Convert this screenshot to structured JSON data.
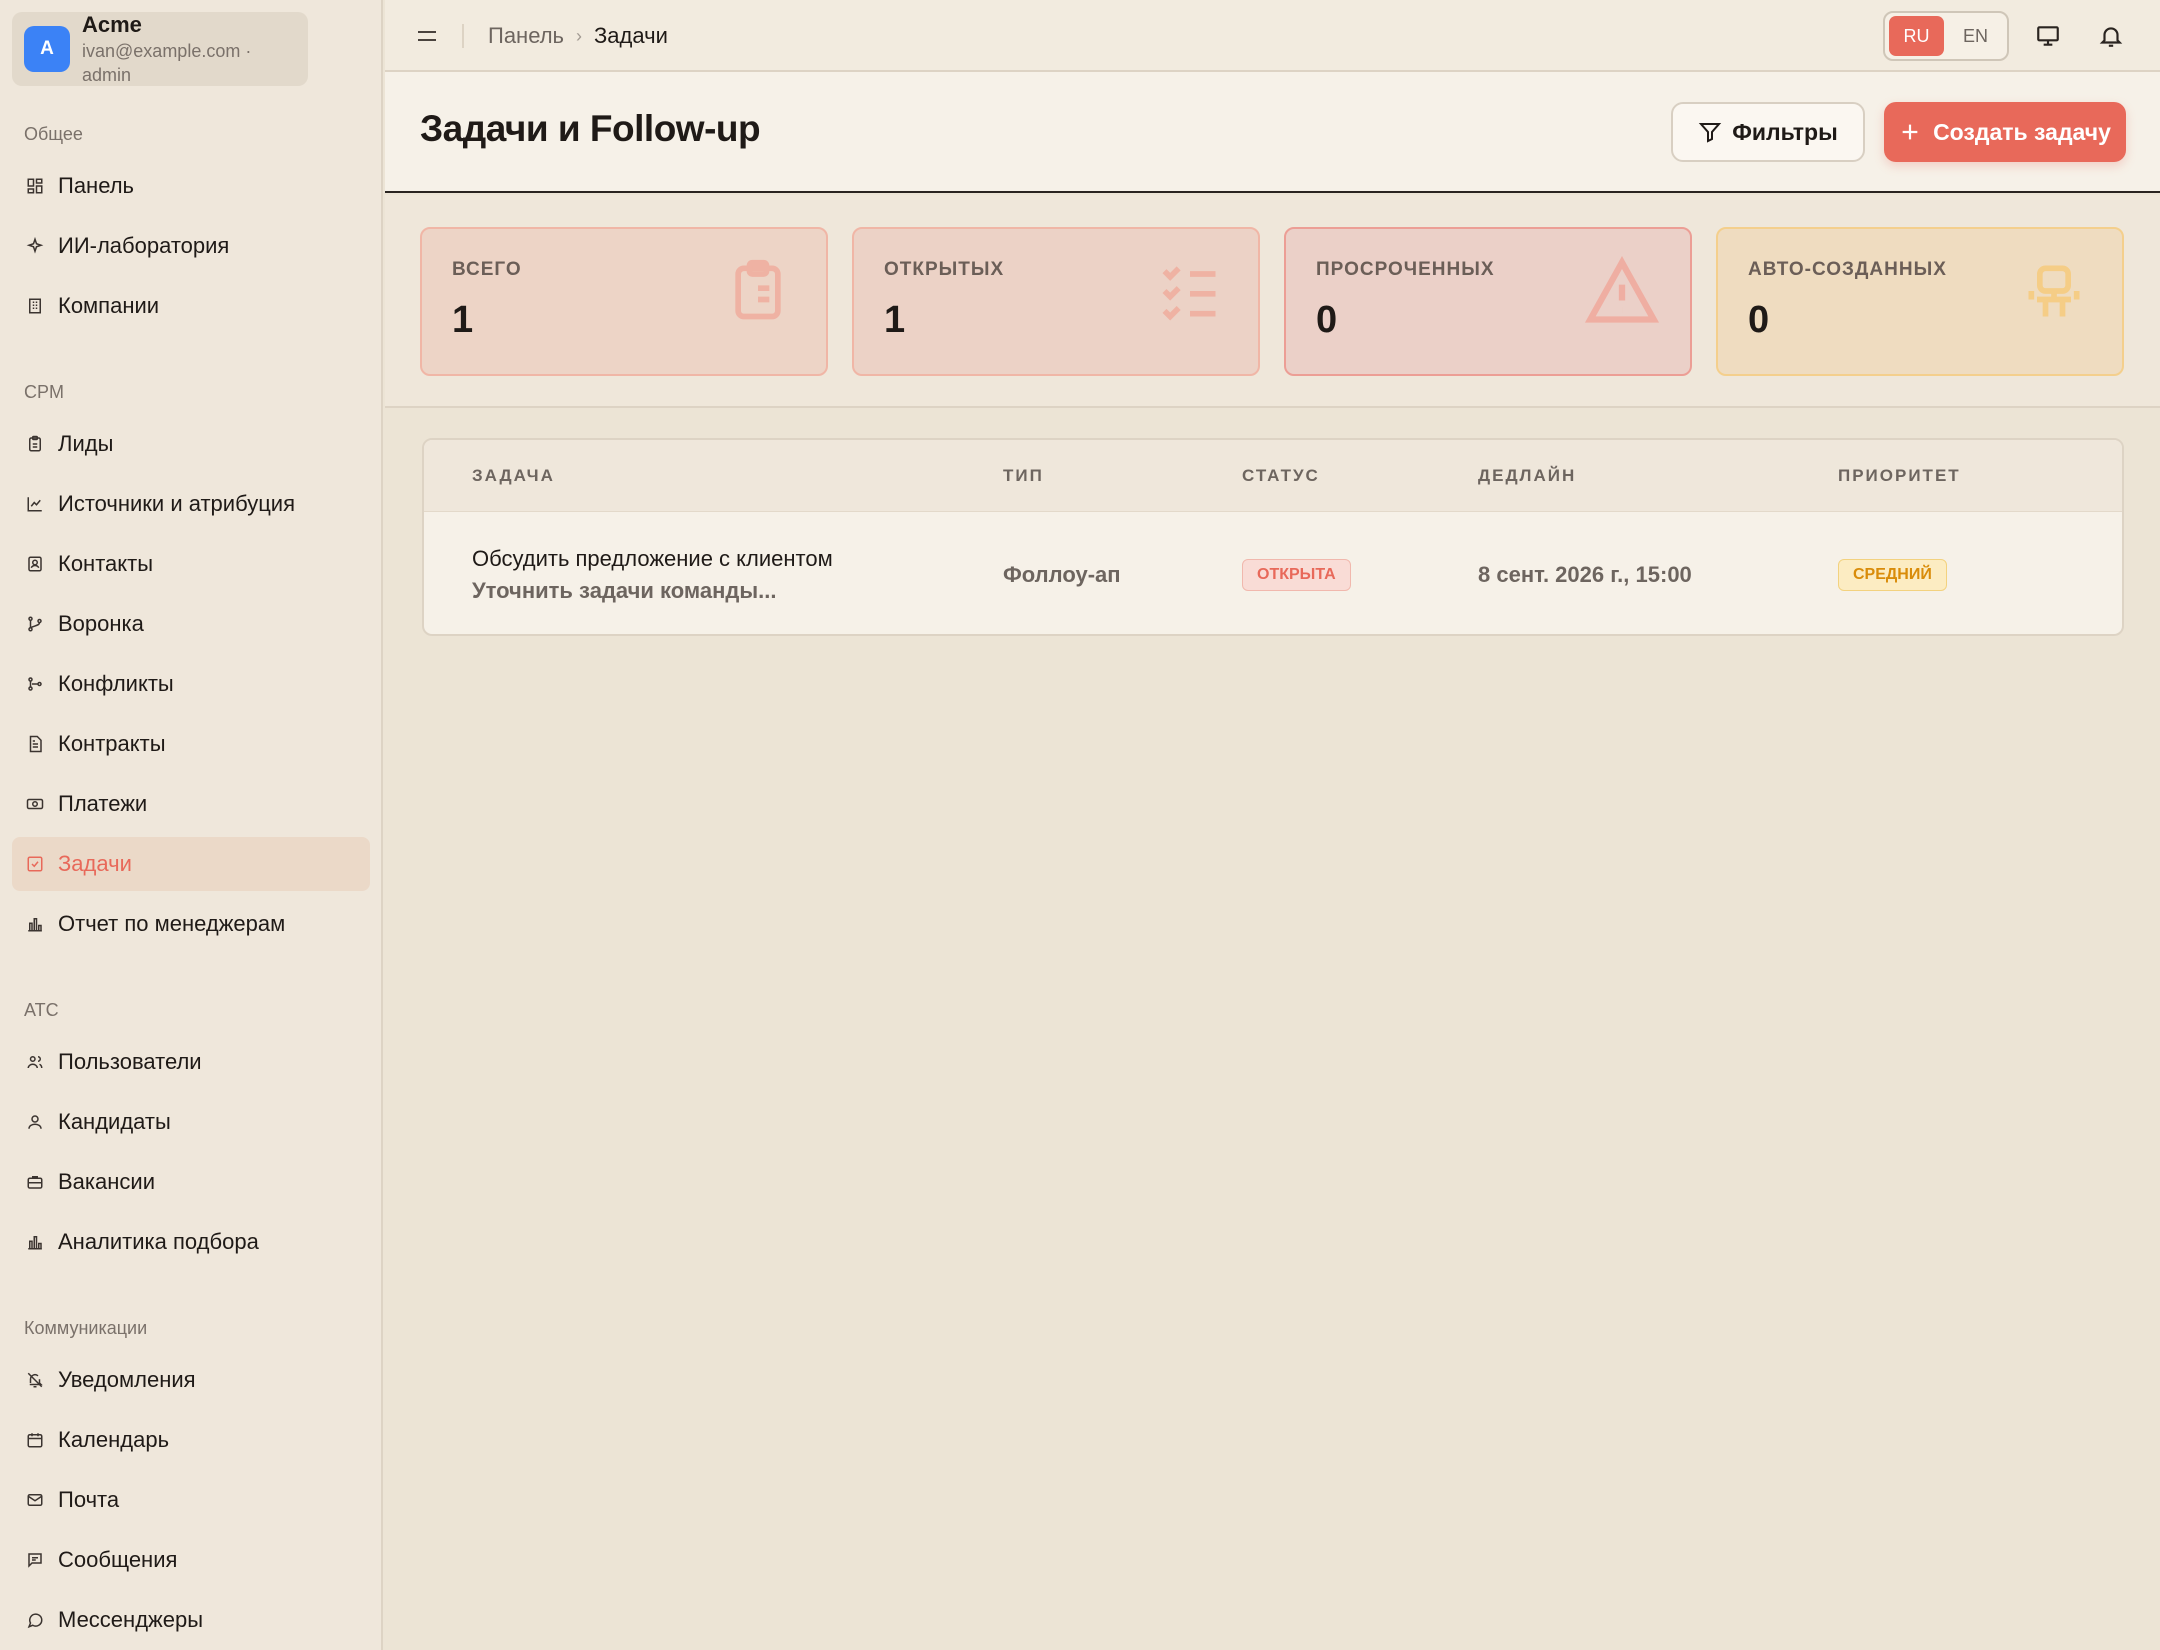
{
  "org": {
    "avatar": "A",
    "name": "Acme",
    "sub": "ivan@example.com · admin"
  },
  "sidebar": {
    "sections": [
      {
        "title": "Общее",
        "items": [
          {
            "label": "Панель",
            "icon": "dashboard-icon"
          },
          {
            "label": "ИИ-лаборатория",
            "icon": "sparkles-icon"
          },
          {
            "label": "Компании",
            "icon": "building-icon"
          }
        ]
      },
      {
        "title": "CPM",
        "items": [
          {
            "label": "Лиды",
            "icon": "clipboard-icon"
          },
          {
            "label": "Источники и атрибуция",
            "icon": "chart-line-icon"
          },
          {
            "label": "Контакты",
            "icon": "contact-icon"
          },
          {
            "label": "Воронка",
            "icon": "funnel-icon"
          },
          {
            "label": "Конфликты",
            "icon": "git-branch-icon"
          },
          {
            "label": "Контракты",
            "icon": "document-icon"
          },
          {
            "label": "Платежи",
            "icon": "banknote-icon"
          },
          {
            "label": "Задачи",
            "icon": "checkbox-icon",
            "active": true
          },
          {
            "label": "Отчет по менеджерам",
            "icon": "bar-chart-icon"
          }
        ]
      },
      {
        "title": "АТС",
        "items": [
          {
            "label": "Пользователи",
            "icon": "users-icon"
          },
          {
            "label": "Кандидаты",
            "icon": "user-icon"
          },
          {
            "label": "Вакансии",
            "icon": "briefcase-icon"
          },
          {
            "label": "Аналитика подбора",
            "icon": "bar-chart-icon"
          }
        ]
      },
      {
        "title": "Коммуникации",
        "items": [
          {
            "label": "Уведомления",
            "icon": "bell-off-icon"
          },
          {
            "label": "Календарь",
            "icon": "calendar-icon"
          },
          {
            "label": "Почта",
            "icon": "mail-icon"
          },
          {
            "label": "Сообщения",
            "icon": "message-square-icon"
          },
          {
            "label": "Мессенджеры",
            "icon": "message-circle-icon"
          }
        ]
      }
    ]
  },
  "topbar": {
    "breadcrumb_parent": "Панель",
    "breadcrumb_current": "Задачи",
    "lang_ru": "RU",
    "lang_en": "EN",
    "active_lang": "RU"
  },
  "header": {
    "title": "Задачи и Follow-up",
    "filter_label": "Фильтры",
    "create_label": "Создать задачу"
  },
  "stats": [
    {
      "label": "ВСЕГО",
      "value": "1",
      "icon": "clipboard-list-icon"
    },
    {
      "label": "ОТКРЫТЫХ",
      "value": "1",
      "icon": "list-checks-icon"
    },
    {
      "label": "ПРОСРОЧЕННЫХ",
      "value": "0",
      "icon": "warning-icon"
    },
    {
      "label": "АВТО-СОЗДАННЫХ",
      "value": "0",
      "icon": "robot-icon"
    }
  ],
  "colors": {
    "accent": "#e8695a",
    "priority_medium": "#d98c0a"
  },
  "table": {
    "columns": [
      "ЗАДАЧА",
      "ТИП",
      "СТАТУС",
      "ДЕДЛАЙН",
      "ПРИОРИТЕТ"
    ],
    "rows": [
      {
        "title": "Обсудить предложение с клиентом",
        "description": "Уточнить задачи команды...",
        "type": "Фоллоу-ап",
        "status": "ОТКРЫТА",
        "deadline": "8 сент. 2026 г., 15:00",
        "priority": "СРЕДНИЙ"
      }
    ]
  }
}
